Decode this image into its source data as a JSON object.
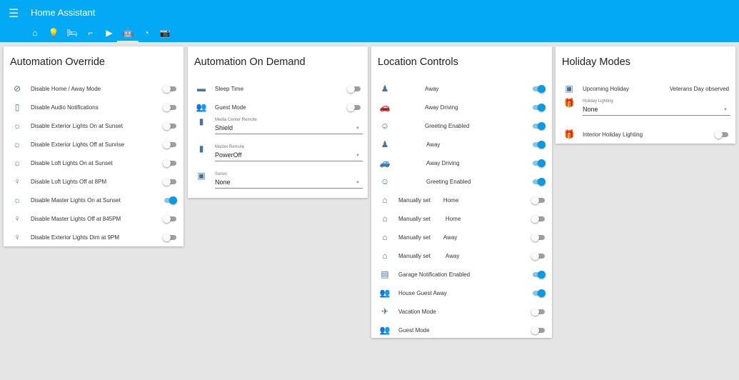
{
  "header": {
    "menu_icon": "menu-icon",
    "title": "Home Assistant",
    "tabs": [
      {
        "icon": "home-icon",
        "glyph": "⌂"
      },
      {
        "icon": "lightbulb-icon",
        "glyph": "💡"
      },
      {
        "icon": "bed-icon",
        "glyph": "🛏"
      },
      {
        "icon": "stairs-icon",
        "glyph": "⌐"
      },
      {
        "icon": "play-circle-icon",
        "glyph": "▶"
      },
      {
        "icon": "robot-icon",
        "glyph": "🤖",
        "active": true
      },
      {
        "icon": "gauge-icon",
        "glyph": "◔"
      },
      {
        "icon": "camera-icon",
        "glyph": "📷"
      }
    ]
  },
  "cards": [
    {
      "title": "Automation Override",
      "rows": [
        {
          "icon": "account-off-icon",
          "g": "⊘",
          "label": "Disable Home / Away Mode",
          "on": false
        },
        {
          "icon": "speaker-off-icon",
          "g": "▯",
          "label": "Disable Audio Notifications",
          "on": false
        },
        {
          "icon": "sunset-icon",
          "g": "☼",
          "label": "Disable Exterior Lights On at Sunset",
          "on": false
        },
        {
          "icon": "sunrise-icon",
          "g": "☼",
          "label": "Disable Exterior Lights Off at Sunrise",
          "on": false
        },
        {
          "icon": "sunset-icon",
          "g": "☼",
          "label": "Disable Loft Lights On at Sunset",
          "on": false
        },
        {
          "icon": "lightbulb-icon",
          "g": "♀",
          "label": "Disable Loft Lights Off at 8PM",
          "on": false
        },
        {
          "icon": "sunset-icon",
          "g": "☼",
          "label": "Disable Master Lights On at Sunset",
          "on": true
        },
        {
          "icon": "lightbulb-icon",
          "g": "♀",
          "label": "Disable Master Lights Off at 845PM",
          "on": false
        },
        {
          "icon": "lightbulb-icon",
          "g": "♀",
          "label": "Disable Exterior Lights Dim at 9PM",
          "on": false
        }
      ]
    },
    {
      "title": "Automation On Demand",
      "rows": [
        {
          "icon": "bed-icon",
          "g": "▬",
          "label": "Sleep Time",
          "on": false
        },
        {
          "icon": "people-icon",
          "g": "👥",
          "label": "Guest Mode",
          "on": false
        },
        {
          "icon": "remote-icon",
          "g": "▮",
          "select": true,
          "label": "Media Center Remote",
          "value": "Shield"
        },
        {
          "icon": "remote-icon",
          "g": "▮",
          "select": true,
          "label": "Master Remote",
          "value": "PowerOff"
        },
        {
          "icon": "speaker-icon",
          "g": "▣",
          "select": true,
          "label": "Sonos",
          "value": "None"
        }
      ]
    },
    {
      "title": "Location Controls",
      "rows": [
        {
          "icon": "person-icon",
          "g": "♟",
          "label": "Away",
          "pad": 46,
          "on": true
        },
        {
          "icon": "car-icon",
          "g": "🚗",
          "label": "Away Driving",
          "pad": 46,
          "on": true
        },
        {
          "icon": "voice-icon",
          "g": "☺",
          "label": "Greeting Enabled",
          "pad": 46,
          "on": true
        },
        {
          "icon": "person-icon",
          "g": "♟",
          "label": "Away",
          "pad": 48,
          "on": true
        },
        {
          "icon": "car-icon",
          "g": "🚙",
          "label": "Away Driving",
          "pad": 48,
          "on": true
        },
        {
          "icon": "voice-icon",
          "g": "☺",
          "label": "Greeting Enabled",
          "pad": 48,
          "on": true
        },
        {
          "icon": "home-icon",
          "g": "⌂",
          "label": "Manually set",
          "state": "Home",
          "sp": 18,
          "on": false
        },
        {
          "icon": "home-icon",
          "g": "⌂",
          "label": "Manually set",
          "state": "Home",
          "sp": 21,
          "on": false
        },
        {
          "icon": "home-outline-icon",
          "g": "⌂",
          "label": "Manually set",
          "state": "Away",
          "sp": 18,
          "on": false
        },
        {
          "icon": "home-outline-icon",
          "g": "⌂",
          "label": "Manually set",
          "state": "Away",
          "sp": 21,
          "on": false
        },
        {
          "icon": "garage-icon",
          "g": "▤",
          "label": "Garage Notification Enabled",
          "on": true
        },
        {
          "icon": "people-icon",
          "g": "👥",
          "label": "House Guest Away",
          "on": true
        },
        {
          "icon": "airplane-icon",
          "g": "✈",
          "label": "Vacation Mode",
          "on": false
        },
        {
          "icon": "people-icon",
          "g": "👥",
          "label": "Guest Mode",
          "on": false
        }
      ]
    },
    {
      "title": "Holiday Modes",
      "rows": [
        {
          "icon": "calendar-icon",
          "g": "▣",
          "label": "Upcoming Holiday",
          "value": "Veterans Day observed",
          "text": true
        },
        {
          "icon": "gift-icon",
          "g": "🎁",
          "select": true,
          "label": "Holiday Lighting",
          "value": "None"
        },
        {
          "icon": "gift-icon",
          "g": "🎁",
          "label": "Interior Holiday Lighting",
          "on": false
        }
      ]
    }
  ]
}
